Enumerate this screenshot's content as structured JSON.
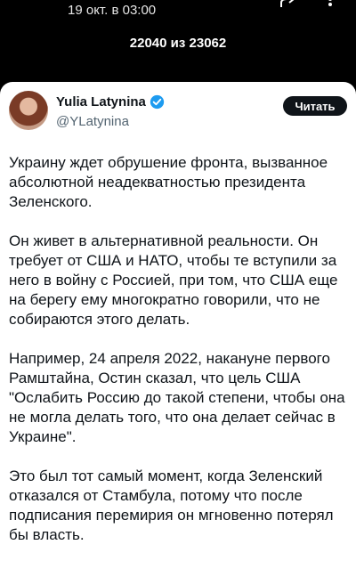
{
  "topbar": {
    "date": "19 окт. в 03:00",
    "counter": "22040 из 23062",
    "share_icon": "share-icon",
    "more_icon": "more-icon"
  },
  "tweet": {
    "author_name": "Yulia Latynina",
    "author_handle": "@YLatynina",
    "verified_icon": "verified-badge-icon",
    "verified_color": "#1d9bf0",
    "follow_label": "Читать",
    "paragraphs": [
      "Украину ждет обрушение фронта, вызванное абсолютной неадекватностью президента Зеленского.",
      "Он живет в альтернативной реальности. Он требует от США и НАТО, чтобы те вступили за него в войну с Россией, при том, что США еще на берегу ему многократно говорили, что не собираются этого делать.",
      "Например, 24 апреля 2022, накануне первого Рамштайна, Остин сказал, что цель США \"Ослабить Россию до такой степени, чтобы она не могла делать того, что она делает сейчас в Украине\".",
      "Это был тот самый момент, когда Зеленский отказался от Стамбула, потому что после подписания перемирия он мгновенно потерял бы власть."
    ]
  }
}
